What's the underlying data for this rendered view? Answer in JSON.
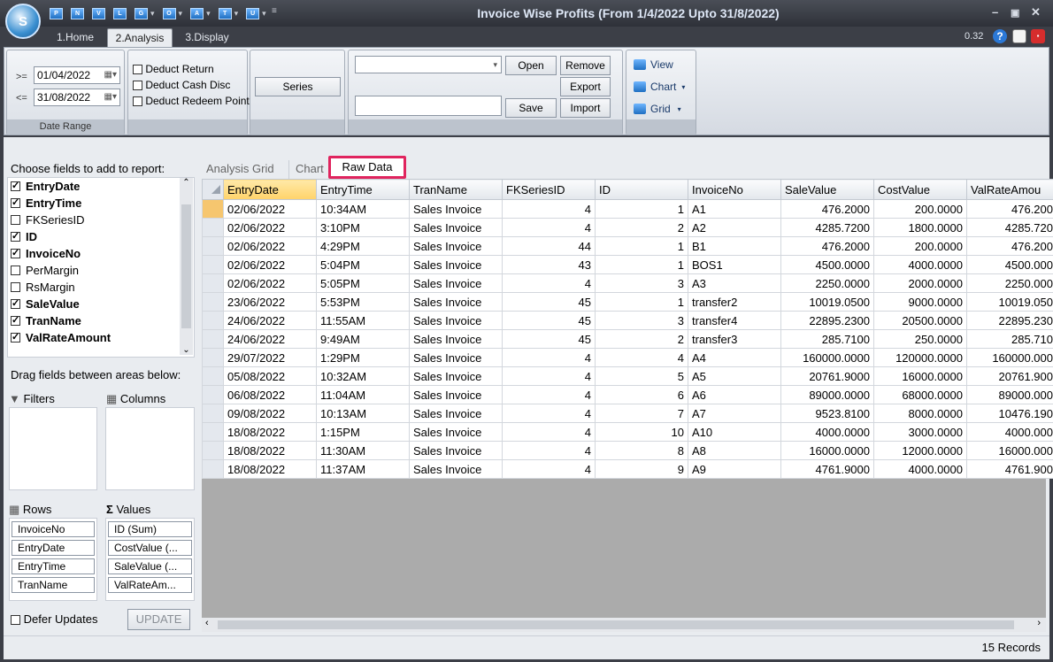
{
  "window": {
    "title": "Invoice Wise Profits (From 1/4/2022 Upto 31/8/2022)",
    "version": "0.32"
  },
  "quick_access": [
    "P",
    "N",
    "V",
    "L",
    "G",
    "O",
    "A",
    "T",
    "U"
  ],
  "tabs": [
    {
      "label": "1.Home"
    },
    {
      "label": "2.Analysis"
    },
    {
      "label": "3.Display"
    }
  ],
  "ribbon": {
    "date_range": {
      "from_op": ">=",
      "from": "01/04/2022",
      "to_op": "<=",
      "to": "31/08/2022",
      "group_label": "Date Range"
    },
    "checks": [
      {
        "label": "Deduct Return",
        "checked": false
      },
      {
        "label": "Deduct Cash Disc",
        "checked": false
      },
      {
        "label": "Deduct Redeem Points",
        "checked": false
      }
    ],
    "series_button": "Series",
    "buttons": {
      "open": "Open",
      "remove": "Remove",
      "export": "Export",
      "save": "Save",
      "import": "Import"
    },
    "view": {
      "view": "View",
      "chart": "Chart",
      "grid": "Grid"
    }
  },
  "fields_panel": {
    "heading": "Choose fields to add to report:",
    "fields": [
      {
        "label": "EntryDate",
        "checked": true
      },
      {
        "label": "EntryTime",
        "checked": true
      },
      {
        "label": "FKSeriesID",
        "checked": false
      },
      {
        "label": "ID",
        "checked": true
      },
      {
        "label": "InvoiceNo",
        "checked": true
      },
      {
        "label": "PerMargin",
        "checked": false
      },
      {
        "label": "RsMargin",
        "checked": false
      },
      {
        "label": "SaleValue",
        "checked": true
      },
      {
        "label": "TranName",
        "checked": true
      },
      {
        "label": "ValRateAmount",
        "checked": true
      }
    ],
    "drag_hint": "Drag fields between areas below:",
    "filters_label": "Filters",
    "columns_label": "Columns",
    "rows_label": "Rows",
    "values_label": "Values",
    "rows": [
      "InvoiceNo",
      "EntryDate",
      "EntryTime",
      "TranName"
    ],
    "values": [
      "ID (Sum)",
      "CostValue (...",
      "SaleValue (...",
      "ValRateAm..."
    ],
    "defer_label": "Defer Updates",
    "update_label": "UPDATE"
  },
  "view_tabs": [
    {
      "label": "Analysis Grid"
    },
    {
      "label": "Chart"
    },
    {
      "label": "Raw Data"
    }
  ],
  "grid": {
    "columns": [
      "EntryDate",
      "EntryTime",
      "TranName",
      "FKSeriesID",
      "ID",
      "InvoiceNo",
      "SaleValue",
      "CostValue",
      "ValRateAmou"
    ],
    "rows": [
      [
        "02/06/2022",
        "10:34AM",
        "Sales Invoice",
        "4",
        "1",
        "A1",
        "476.2000",
        "200.0000",
        "476.200"
      ],
      [
        "02/06/2022",
        "3:10PM",
        "Sales Invoice",
        "4",
        "2",
        "A2",
        "4285.7200",
        "1800.0000",
        "4285.720"
      ],
      [
        "02/06/2022",
        "4:29PM",
        "Sales Invoice",
        "44",
        "1",
        "B1",
        "476.2000",
        "200.0000",
        "476.200"
      ],
      [
        "02/06/2022",
        "5:04PM",
        "Sales Invoice",
        "43",
        "1",
        "BOS1",
        "4500.0000",
        "4000.0000",
        "4500.000"
      ],
      [
        "02/06/2022",
        "5:05PM",
        "Sales Invoice",
        "4",
        "3",
        "A3",
        "2250.0000",
        "2000.0000",
        "2250.000"
      ],
      [
        "23/06/2022",
        "5:53PM",
        "Sales Invoice",
        "45",
        "1",
        "transfer2",
        "10019.0500",
        "9000.0000",
        "10019.050"
      ],
      [
        "24/06/2022",
        "11:55AM",
        "Sales Invoice",
        "45",
        "3",
        "transfer4",
        "22895.2300",
        "20500.0000",
        "22895.230"
      ],
      [
        "24/06/2022",
        "9:49AM",
        "Sales Invoice",
        "45",
        "2",
        "transfer3",
        "285.7100",
        "250.0000",
        "285.710"
      ],
      [
        "29/07/2022",
        "1:29PM",
        "Sales Invoice",
        "4",
        "4",
        "A4",
        "160000.0000",
        "120000.0000",
        "160000.000"
      ],
      [
        "05/08/2022",
        "10:32AM",
        "Sales Invoice",
        "4",
        "5",
        "A5",
        "20761.9000",
        "16000.0000",
        "20761.900"
      ],
      [
        "06/08/2022",
        "11:04AM",
        "Sales Invoice",
        "4",
        "6",
        "A6",
        "89000.0000",
        "68000.0000",
        "89000.000"
      ],
      [
        "09/08/2022",
        "10:13AM",
        "Sales Invoice",
        "4",
        "7",
        "A7",
        "9523.8100",
        "8000.0000",
        "10476.190"
      ],
      [
        "18/08/2022",
        "1:15PM",
        "Sales Invoice",
        "4",
        "10",
        "A10",
        "4000.0000",
        "3000.0000",
        "4000.000"
      ],
      [
        "18/08/2022",
        "11:30AM",
        "Sales Invoice",
        "4",
        "8",
        "A8",
        "16000.0000",
        "12000.0000",
        "16000.000"
      ],
      [
        "18/08/2022",
        "11:37AM",
        "Sales Invoice",
        "4",
        "9",
        "A9",
        "4761.9000",
        "4000.0000",
        "4761.900"
      ]
    ]
  },
  "status": {
    "records": "15 Records"
  },
  "colors": {
    "accent": "#1f6fc2",
    "highlight_tab_border": "#e0245e",
    "selected_header": "#ffd36a"
  }
}
